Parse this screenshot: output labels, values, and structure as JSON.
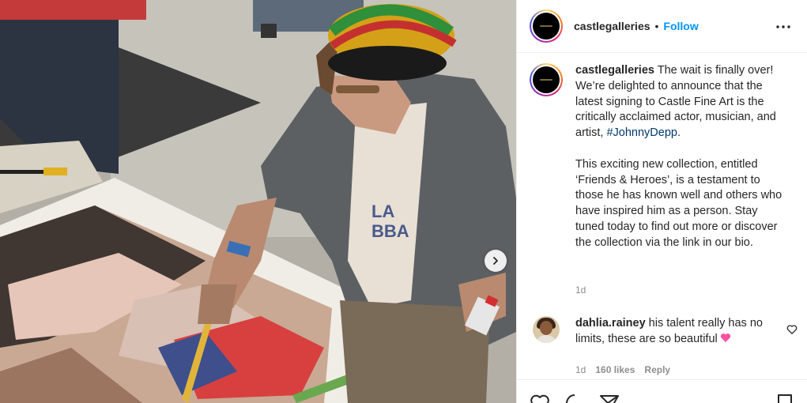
{
  "post": {
    "image_alt": "",
    "username": "castlegalleries",
    "follow_label": "Follow",
    "separator": "•",
    "icons": {
      "more": "more-options-icon",
      "carousel": "chevron-right-icon",
      "comment_like": "heart-outline-icon",
      "like": "heart-outline-icon",
      "comment": "comment-bubble-icon",
      "share": "paper-plane-icon",
      "save": "bookmark-icon"
    },
    "colors": {
      "follow": "#0095f6",
      "hashtag": "#00376b",
      "muted": "#8e8e8e",
      "text": "#262626"
    }
  },
  "caption": {
    "username": "castlegalleries",
    "paragraph1_before": " The wait is finally over! We’re delighted to announce that the latest signing to Castle Fine Art is the critically acclaimed actor, musician, and artist, ",
    "hashtag": "#JohnnyDepp",
    "paragraph1_after": ".",
    "paragraph2": "This exciting new collection, entitled ‘Friends & Heroes’, is a testament to those he has known well and others who have inspired him as a person. Stay tuned today to find out more or discover the collection via the link in our bio.",
    "time": "1d"
  },
  "comment": {
    "username": "dahlia.rainey",
    "text": " his talent really has no limits, these are so beautiful",
    "time": "1d",
    "likes": "160 likes",
    "reply_label": "Reply"
  }
}
